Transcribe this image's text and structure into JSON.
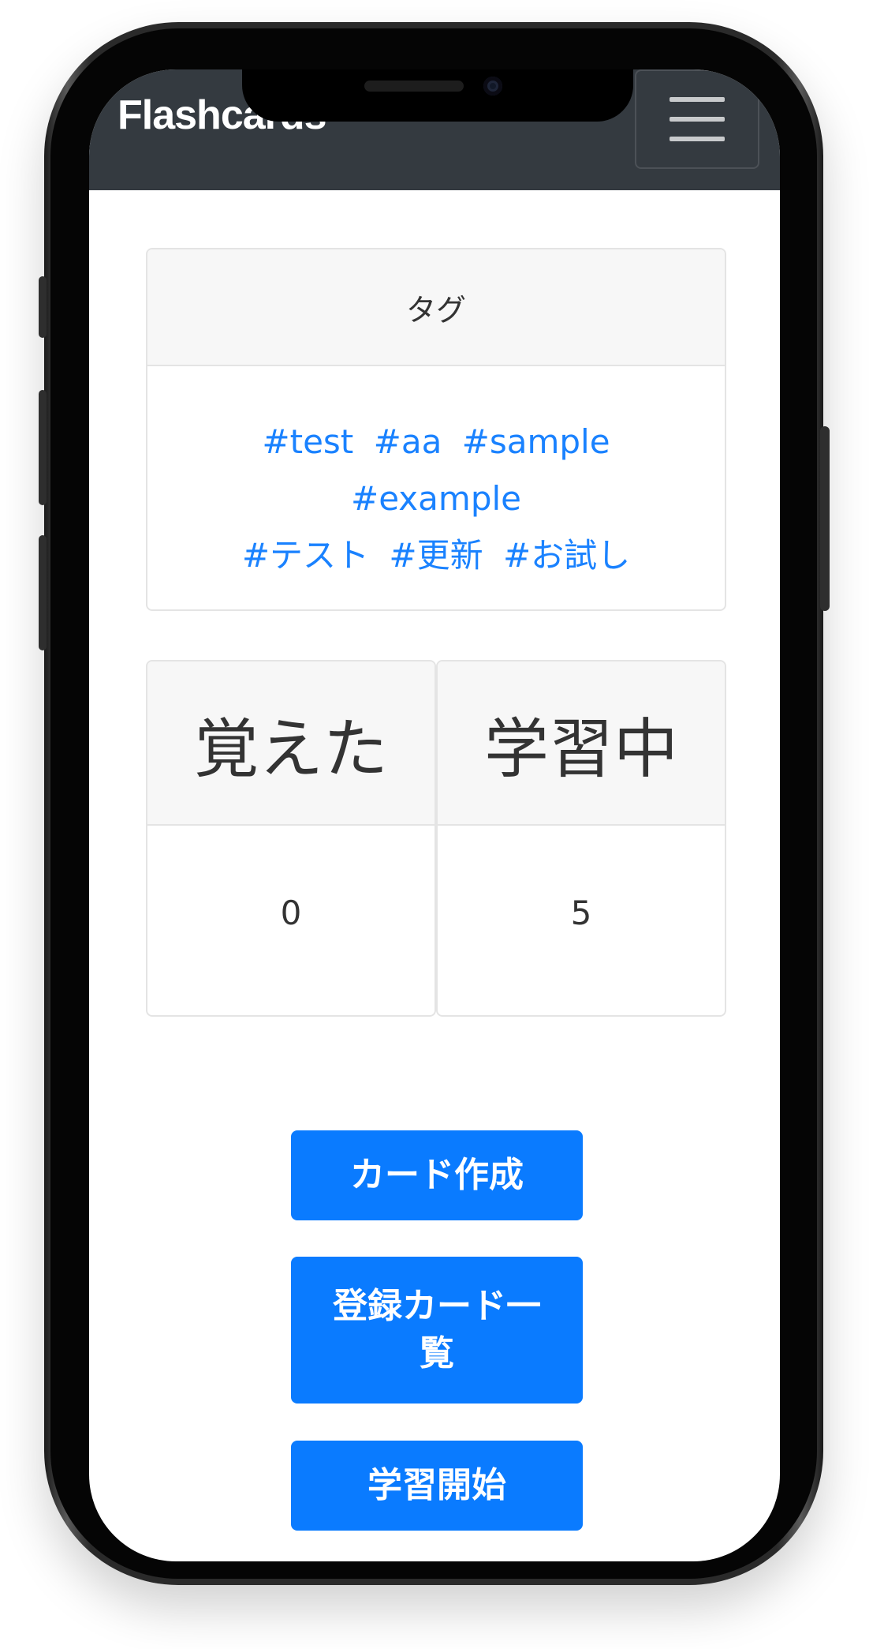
{
  "navbar": {
    "brand": "Flashcards",
    "menu_icon": "hamburger-menu-icon"
  },
  "tags": {
    "header": "タグ",
    "items": [
      "#test",
      "#aa",
      "#sample",
      "#example",
      "#テスト",
      "#更新",
      "#お試し"
    ]
  },
  "stats": {
    "learned": {
      "label": "覚えた",
      "value": "0"
    },
    "studying": {
      "label": "学習中",
      "value": "5"
    }
  },
  "actions": {
    "create_card": "カード作成",
    "card_list": "登録カード一覧",
    "start_study": "学習開始"
  },
  "colors": {
    "navbar": "#343a40",
    "primary": "#0a7bff",
    "link": "#1a82ff"
  }
}
